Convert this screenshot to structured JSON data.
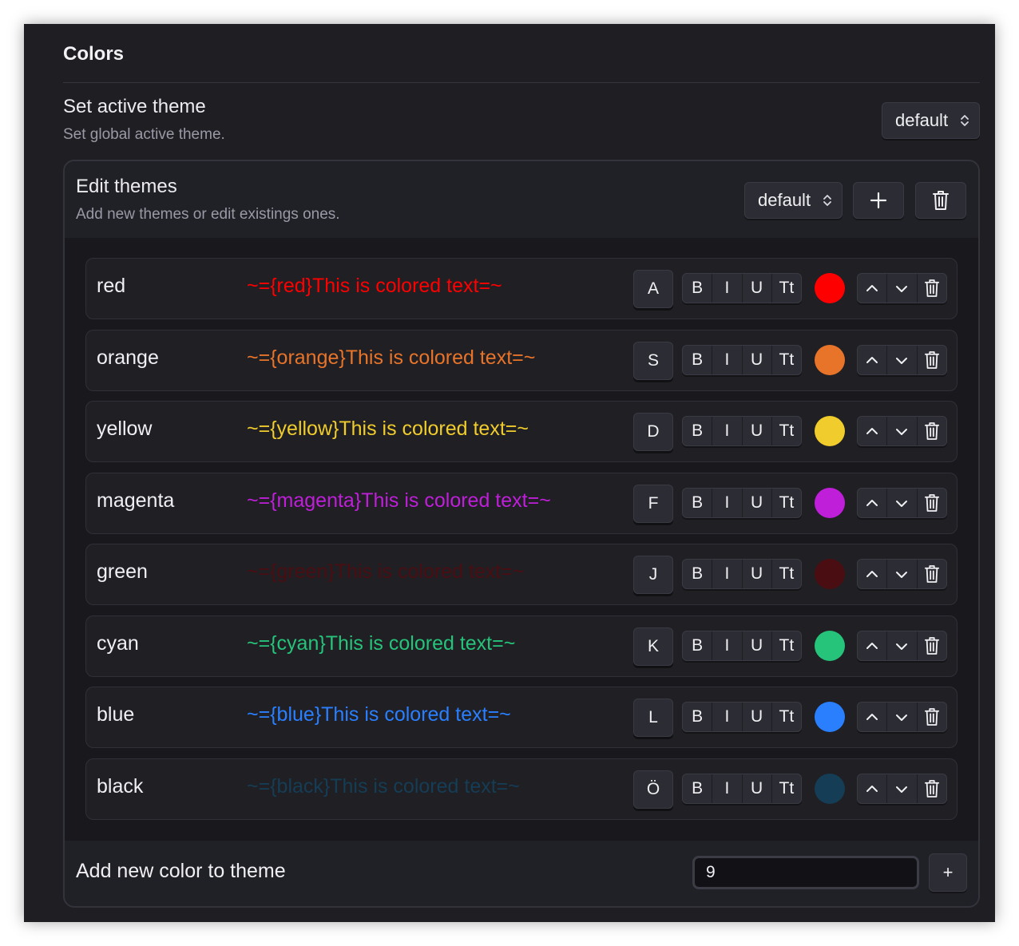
{
  "section": {
    "title": "Colors"
  },
  "active_theme": {
    "title": "Set active theme",
    "description": "Set global active theme.",
    "selected": "default"
  },
  "edit_themes": {
    "title": "Edit themes",
    "description": "Add new themes or edit existings ones.",
    "selected": "default"
  },
  "format_buttons": {
    "bold": "B",
    "italic": "I",
    "underline": "U",
    "size": "Tt"
  },
  "colors": [
    {
      "name": "red",
      "sample": "~={red}This is colored text=~",
      "key": "A",
      "hex": "#ff0000"
    },
    {
      "name": "orange",
      "sample": "~={orange}This is colored text=~",
      "key": "S",
      "hex": "#e8742a"
    },
    {
      "name": "yellow",
      "sample": "~={yellow}This is colored text=~",
      "key": "D",
      "hex": "#f0cc2c"
    },
    {
      "name": "magenta",
      "sample": "~={magenta}This is colored text=~",
      "key": "F",
      "hex": "#bf1fd9"
    },
    {
      "name": "green",
      "sample": "~={green}This is colored text=~",
      "key": "J",
      "hex": "#4a0e12"
    },
    {
      "name": "cyan",
      "sample": "~={cyan}This is colored text=~",
      "key": "K",
      "hex": "#25c47a"
    },
    {
      "name": "blue",
      "sample": "~={blue}This is colored text=~",
      "key": "L",
      "hex": "#2a7fff"
    },
    {
      "name": "black",
      "sample": "~={black}This is colored text=~",
      "key": "Ö",
      "hex": "#153d55"
    }
  ],
  "add_color": {
    "label": "Add new color to theme",
    "value": "9",
    "button": "+"
  }
}
